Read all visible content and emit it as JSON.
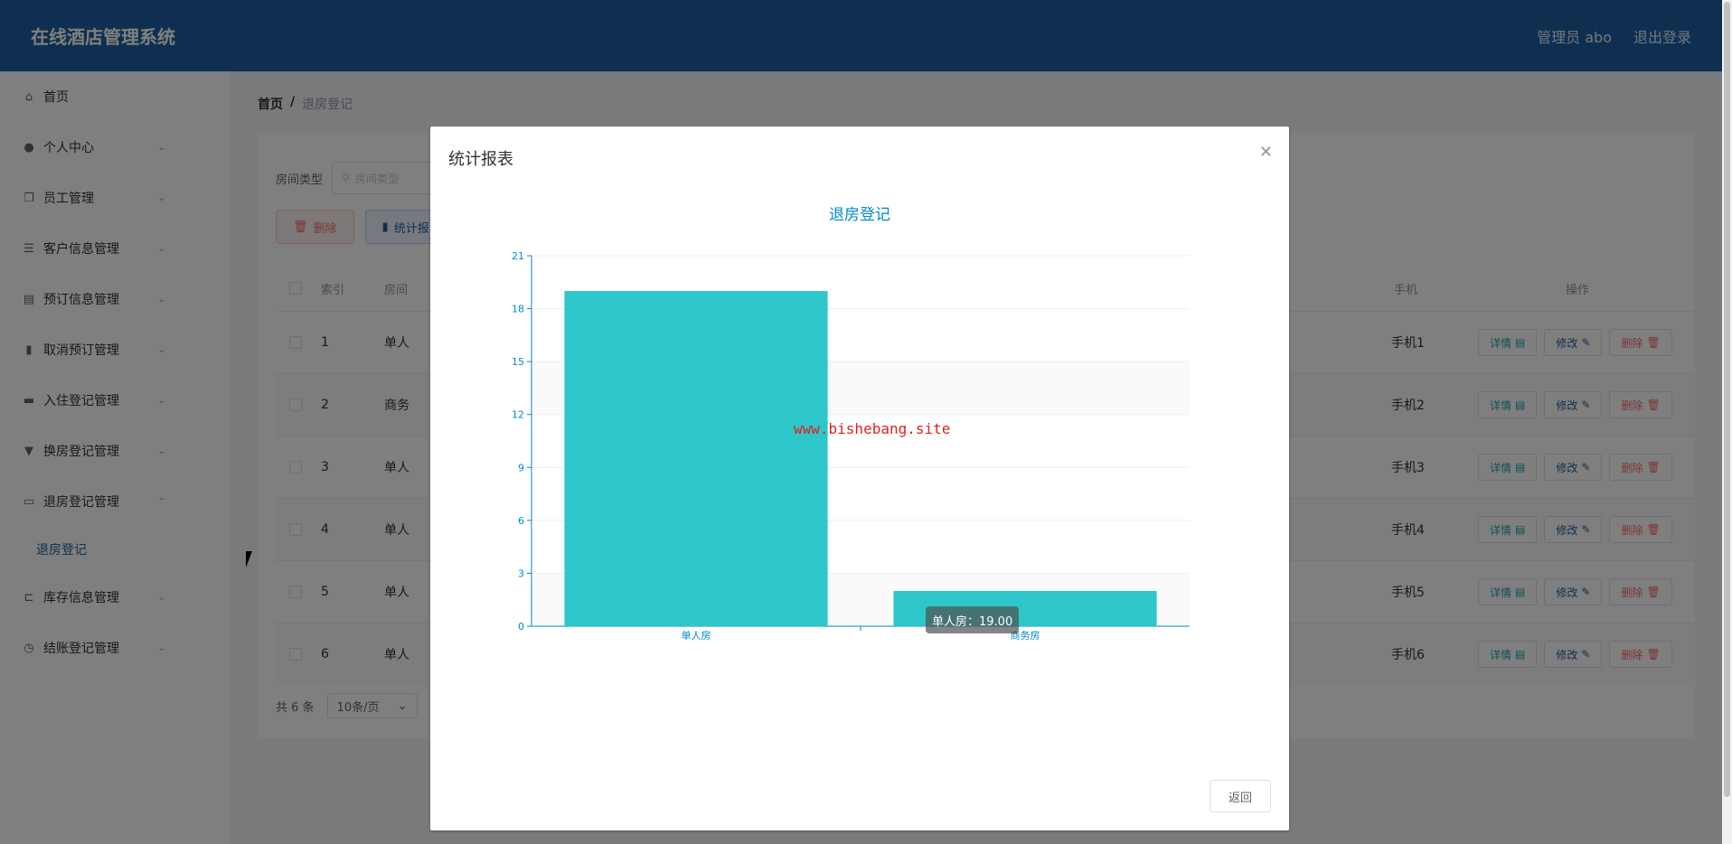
{
  "header": {
    "app_title": "在线酒店管理系统",
    "admin": "管理员 abo",
    "logout": "退出登录"
  },
  "sidebar": {
    "items": [
      {
        "label": "首页",
        "icon": "home-icon",
        "chev": ""
      },
      {
        "label": "个人中心",
        "icon": "user-icon",
        "chev": "⌄"
      },
      {
        "label": "员工管理",
        "icon": "copy-icon",
        "chev": "⌄"
      },
      {
        "label": "客户信息管理",
        "icon": "menu-icon",
        "chev": "⌄"
      },
      {
        "label": "预订信息管理",
        "icon": "clipboard-icon",
        "chev": "⌄"
      },
      {
        "label": "取消预订管理",
        "icon": "chart-icon",
        "chev": "⌄"
      },
      {
        "label": "入住登记管理",
        "icon": "chat-icon",
        "chev": "⌄"
      },
      {
        "label": "换房登记管理",
        "icon": "coffee-icon",
        "chev": "⌄"
      },
      {
        "label": "退房登记管理",
        "icon": "message-icon",
        "chev": "⌃"
      }
    ],
    "sub_item": "退房登记",
    "items_after": [
      {
        "label": "库存信息管理",
        "icon": "crop-icon",
        "chev": "⌄"
      },
      {
        "label": "结账登记管理",
        "icon": "clock-icon",
        "chev": "⌄"
      }
    ]
  },
  "breadcrumb": {
    "home": "首页",
    "sep": "/",
    "current": "退房登记"
  },
  "filter": {
    "label": "房间类型",
    "placeholder": "房间类型"
  },
  "toolbar": {
    "delete": "删除",
    "stats": "统计报"
  },
  "table": {
    "headers": {
      "index": "索引",
      "room": "房间",
      "phone": "手机",
      "ops": "操作"
    },
    "rows": [
      {
        "index": "1",
        "room": "单人",
        "phone": "手机1"
      },
      {
        "index": "2",
        "room": "商务",
        "phone": "手机2"
      },
      {
        "index": "3",
        "room": "单人",
        "phone": "手机3"
      },
      {
        "index": "4",
        "room": "单人",
        "phone": "手机4"
      },
      {
        "index": "5",
        "room": "单人",
        "phone": "手机5"
      },
      {
        "index": "6",
        "room": "单人",
        "phone": "手机6"
      }
    ],
    "btn_detail": "详情",
    "btn_edit": "修改",
    "btn_delete": "删除"
  },
  "pager": {
    "total": "共 6 条",
    "size": "10条/页"
  },
  "modal": {
    "title": "统计报表",
    "return_label": "返回",
    "watermark": "www.bishebang.site",
    "tooltip": "单人房：19.00"
  },
  "chart_data": {
    "type": "bar",
    "title": "退房登记",
    "categories": [
      "单人房",
      "商务房"
    ],
    "values": [
      19,
      2
    ],
    "ylim": [
      0,
      21
    ],
    "yticks": [
      0,
      3,
      6,
      9,
      12,
      15,
      18,
      21
    ],
    "grid": true,
    "color": "#2ec7c9",
    "axis_color": "#008acd"
  }
}
